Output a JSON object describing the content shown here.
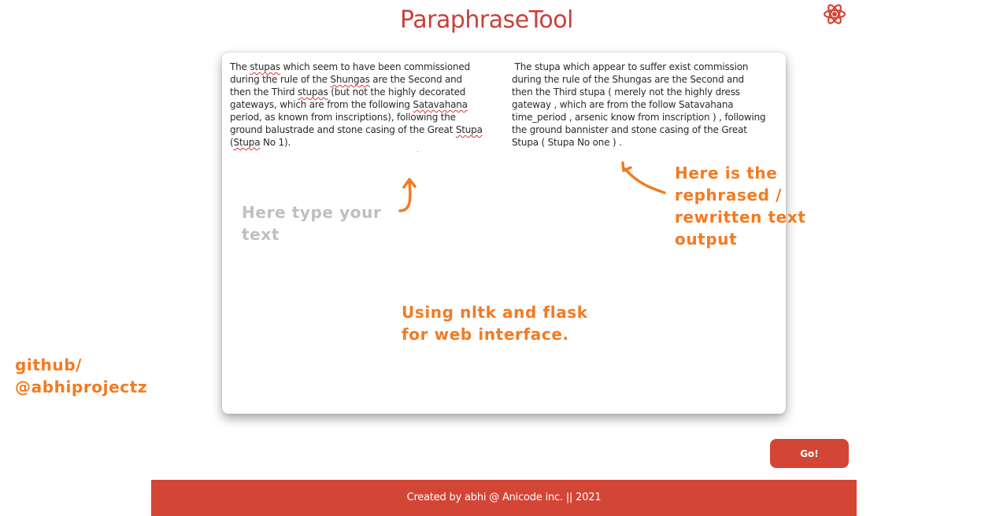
{
  "app": {
    "title": "ParaphraseTool",
    "settings_icon": "atom-icon"
  },
  "input": {
    "segments": [
      {
        "text": "The ",
        "spell": false
      },
      {
        "text": "stupas",
        "spell": true
      },
      {
        "text": " which seem to have been commissioned\nduring the rule of the ",
        "spell": false
      },
      {
        "text": "Shungas",
        "spell": true
      },
      {
        "text": " are the Second and\nthen the Third ",
        "spell": false
      },
      {
        "text": "stupas",
        "spell": true
      },
      {
        "text": " (but not the highly decorated\ngateways, which are from the following ",
        "spell": false
      },
      {
        "text": "Satavahana",
        "spell": true
      },
      {
        "text": "\nperiod, as known from inscriptions), following the\nground balustrade and stone casing of the Great ",
        "spell": false
      },
      {
        "text": "Stupa",
        "spell": true
      },
      {
        "text": "\n(",
        "spell": false
      },
      {
        "text": "Stupa",
        "spell": true
      },
      {
        "text": " No 1).",
        "spell": false
      }
    ]
  },
  "output": {
    "text": " The stupa which appear to suffer exist commission\nduring the rule of the Shungas are the Second and\nthen the Third stupa ( merely not the highly dress\ngateway , which are from the follow Satavahana\ntime_period , arsenic know from inscription ) , following\nthe ground bannister and stone casing of the Great\nStupa ( Stupa No one ) ."
  },
  "annotations": {
    "input_hint_line1": "Here type your",
    "input_hint_line2": "text",
    "output_hint_line1": "Here is the",
    "output_hint_line2": "rephrased /",
    "output_hint_line3": "rewritten text",
    "output_hint_line4": "output",
    "tech_line1": "Using nltk and flask",
    "tech_line2": "for web interface.",
    "github_line1": "github/",
    "github_line2": "@abhiprojectz"
  },
  "actions": {
    "go_label": "Go!"
  },
  "footer": {
    "text": "Created by abhi @ Anicode inc. || 2021"
  },
  "colors": {
    "brand": "#d34535",
    "title": "#c9403a",
    "annotation": "#f47a20",
    "hint": "#bfbfbf"
  }
}
